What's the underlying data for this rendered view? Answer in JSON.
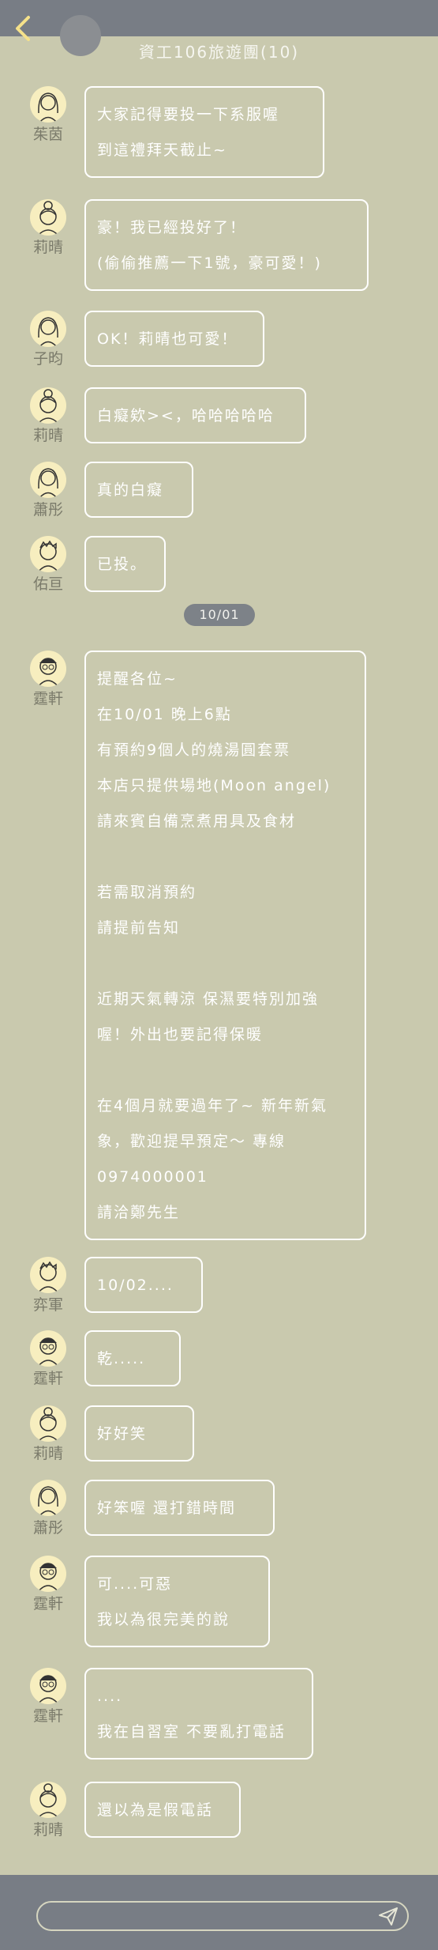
{
  "header": {
    "title": "資工106旅遊團(10)"
  },
  "date_divider": "10/01",
  "colors": {
    "background": "#c9c9ae",
    "bar": "#787d85",
    "avatar_bg": "#f7eebf",
    "bubble_border": "#ffffff",
    "pill": "#7d8288"
  },
  "messages": [
    {
      "sender": "茱茵",
      "avatar_icon": "long-hair-girl-avatar-icon",
      "lines": [
        "大家記得要投一下系服喔",
        "到這禮拜天截止~"
      ]
    },
    {
      "sender": "莉晴",
      "avatar_icon": "bun-hair-girl-avatar-icon",
      "lines": [
        "豪！我已經投好了！",
        "(偷偷推薦一下1號，豪可愛！)"
      ]
    },
    {
      "sender": "子昀",
      "avatar_icon": "ponytail-girl-avatar-icon",
      "lines": [
        "OK！莉晴也可愛！"
      ]
    },
    {
      "sender": "莉晴",
      "avatar_icon": "bun-hair-girl-avatar-icon",
      "lines": [
        "白癡欸><，哈哈哈哈哈"
      ]
    },
    {
      "sender": "蕭彤",
      "avatar_icon": "short-hair-girl-avatar-icon",
      "lines": [
        "真的白癡"
      ]
    },
    {
      "sender": "佑亘",
      "avatar_icon": "boy-avatar-icon",
      "lines": [
        "已投。"
      ]
    },
    {
      "sender": "霆軒",
      "avatar_icon": "glasses-boy-avatar-icon",
      "lines": [
        "提醒各位~",
        "在10/01 晚上6點",
        "有預約9個人的燒湯圓套票",
        "本店只提供場地(Moon angel)",
        "請來賓自備烹煮用具及食材",
        "",
        "若需取消預約",
        "請提前告知",
        "",
        "近期天氣轉涼 保濕要特別加強",
        "喔！外出也要記得保暖",
        "",
        "在4個月就要過年了~ 新年新氣",
        "象，歡迎提早預定～ 專線",
        "0974000001",
        "請洽鄭先生"
      ]
    },
    {
      "sender": "弈軍",
      "avatar_icon": "spiky-hair-boy-avatar-icon",
      "lines": [
        "10/02...."
      ]
    },
    {
      "sender": "霆軒",
      "avatar_icon": "glasses-boy-avatar-icon",
      "lines": [
        "乾....."
      ]
    },
    {
      "sender": "莉晴",
      "avatar_icon": "bun-hair-girl-avatar-icon",
      "lines": [
        "好好笑"
      ]
    },
    {
      "sender": "蕭彤",
      "avatar_icon": "short-hair-girl-avatar-icon",
      "lines": [
        "好笨喔 還打錯時間"
      ]
    },
    {
      "sender": "霆軒",
      "avatar_icon": "glasses-boy-avatar-icon",
      "lines": [
        "可....可惡",
        "我以為很完美的說"
      ]
    },
    {
      "sender": "霆軒",
      "avatar_icon": "glasses-boy-avatar-icon",
      "lines": [
        "....",
        "我在自習室 不要亂打電話"
      ]
    },
    {
      "sender": "莉晴",
      "avatar_icon": "bun-hair-girl-avatar-icon",
      "lines": [
        "還以為是假電話"
      ]
    }
  ],
  "input": {
    "placeholder": ""
  }
}
